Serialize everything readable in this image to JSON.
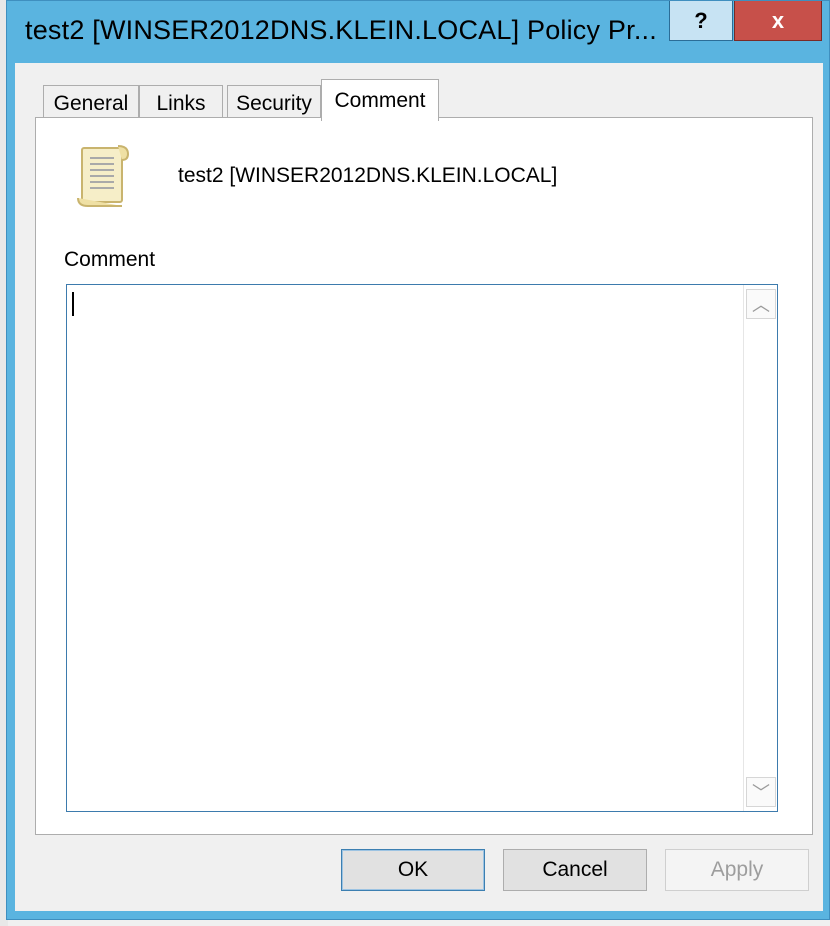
{
  "window": {
    "title": "test2 [WINSER2012DNS.KLEIN.LOCAL] Policy Pr...",
    "help_label": "?",
    "close_label": "x"
  },
  "tabs": [
    {
      "label": "General",
      "active": false
    },
    {
      "label": "Links",
      "active": false
    },
    {
      "label": "Security",
      "active": false
    },
    {
      "label": "Comment",
      "active": true
    }
  ],
  "panel": {
    "gpo_icon": "document-scroll-icon",
    "gpo_name": "test2 [WINSER2012DNS.KLEIN.LOCAL]",
    "comment_label": "Comment",
    "comment_value": ""
  },
  "buttons": {
    "ok": "OK",
    "cancel": "Cancel",
    "apply": "Apply"
  },
  "colors": {
    "frame": "#5ab4e0",
    "close": "#c7504a",
    "focus_border": "#3d7bad"
  }
}
